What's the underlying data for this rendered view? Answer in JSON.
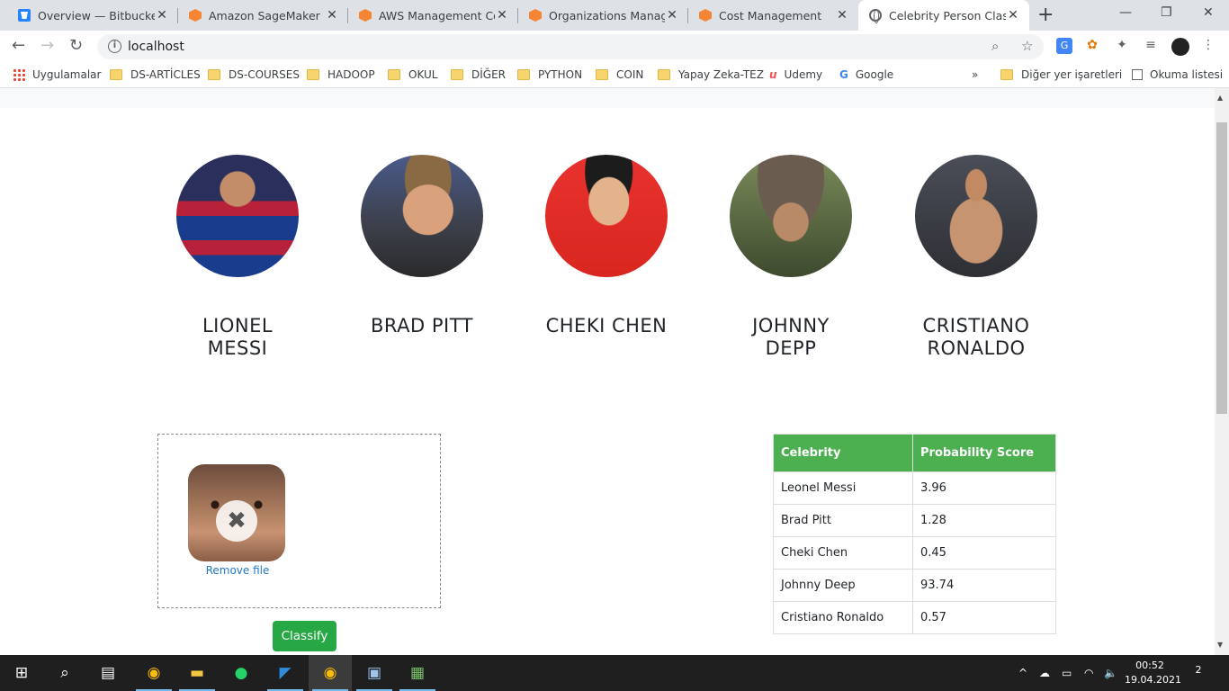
{
  "browser": {
    "tabs": [
      {
        "title": "Overview — Bitbucket",
        "favicon": "bitbucket-icon",
        "active": false
      },
      {
        "title": "Amazon SageMaker",
        "favicon": "aws-icon",
        "active": false
      },
      {
        "title": "AWS Management Con",
        "favicon": "aws-icon",
        "active": false
      },
      {
        "title": "Organizations Manager",
        "favicon": "aws-icon",
        "active": false
      },
      {
        "title": "Cost Management",
        "favicon": "aws-icon",
        "active": false
      },
      {
        "title": "Celebrity Person Classif",
        "favicon": "globe-icon",
        "active": true
      }
    ],
    "url": "localhost",
    "bookmarks": [
      {
        "label": "Uygulamalar",
        "icon": "apps-grid-icon"
      },
      {
        "label": "DS-ARTİCLES",
        "icon": "folder-icon"
      },
      {
        "label": "DS-COURSES",
        "icon": "folder-icon"
      },
      {
        "label": "HADOOP",
        "icon": "folder-icon"
      },
      {
        "label": "OKUL",
        "icon": "folder-icon"
      },
      {
        "label": "DİĞER",
        "icon": "folder-icon"
      },
      {
        "label": "PYTHON",
        "icon": "folder-icon"
      },
      {
        "label": "COIN",
        "icon": "folder-icon"
      },
      {
        "label": "Yapay Zeka-TEZ",
        "icon": "folder-icon"
      },
      {
        "label": "Udemy",
        "icon": "udemy-icon"
      },
      {
        "label": "Google",
        "icon": "google-icon"
      }
    ],
    "bookmarks_right": [
      {
        "label": "Diğer yer işaretleri",
        "icon": "folder-icon"
      },
      {
        "label": "Okuma listesi",
        "icon": "reading-list-icon"
      }
    ],
    "overflow_label": "»"
  },
  "page": {
    "celebrities": [
      {
        "name_line1": "LIONEL",
        "name_line2": "MESSI",
        "accent": "#1a3c8c"
      },
      {
        "name_line1": "BRAD PITT",
        "name_line2": "",
        "accent": "#5a5f66"
      },
      {
        "name_line1": "CHEKI CHEN",
        "name_line2": "",
        "accent": "#e8322f"
      },
      {
        "name_line1": "JOHNNY",
        "name_line2": "DEPP",
        "accent": "#4a4a3e"
      },
      {
        "name_line1": "CRISTIANO",
        "name_line2": "RONALDO",
        "accent": "#6b5a4a"
      }
    ],
    "dropzone": {
      "remove_label": "Remove file",
      "remove_glyph": "✖"
    },
    "classify_label": "Classify",
    "results": {
      "headers": [
        "Celebrity",
        "Probability Score"
      ],
      "rows": [
        [
          "Leonel Messi",
          "3.96"
        ],
        [
          "Brad Pitt",
          "1.28"
        ],
        [
          "Cheki Chen",
          "0.45"
        ],
        [
          "Johnny Deep",
          "93.74"
        ],
        [
          "Cristiano Ronaldo",
          "0.57"
        ]
      ]
    }
  },
  "taskbar": {
    "time": "00:52",
    "date": "19.04.2021",
    "notifications": "2"
  }
}
